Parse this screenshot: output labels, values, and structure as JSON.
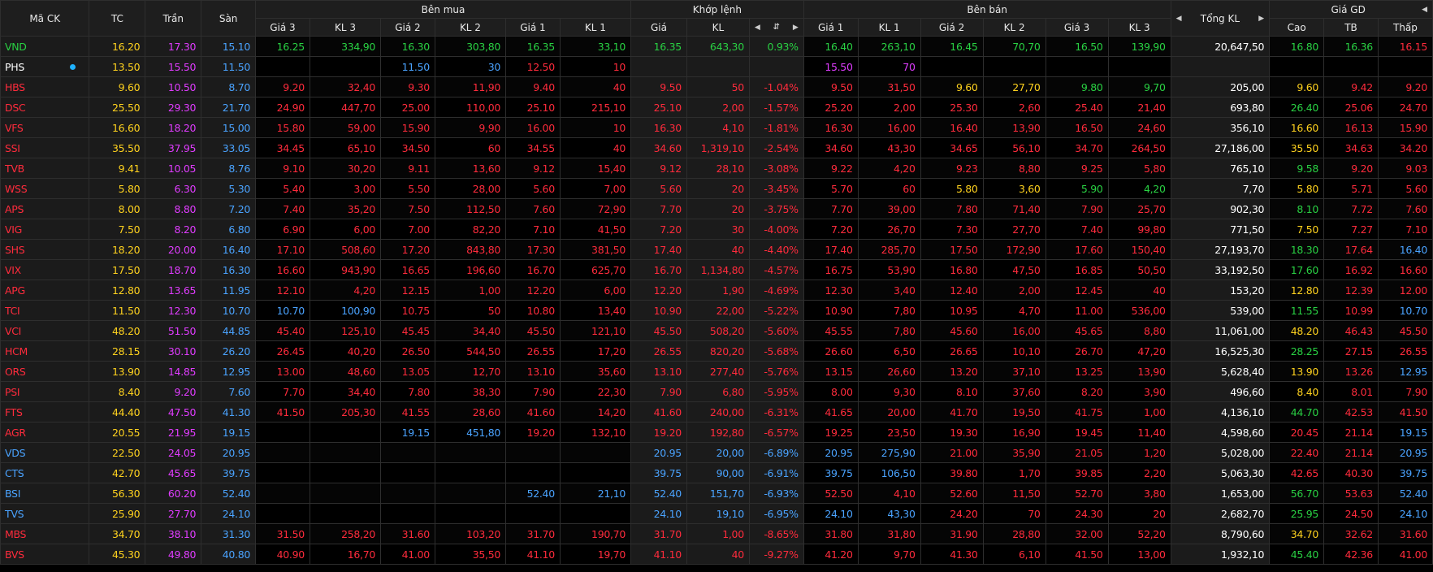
{
  "header": {
    "symbol": "Mã CK",
    "tc": "TC",
    "ceil": "Trần",
    "floor": "Sàn",
    "buy_group": "Bên mua",
    "match_group": "Khớp lệnh",
    "sell_group": "Bên bán",
    "total": "Tổng KL",
    "price_group": "Giá GD",
    "buy_cols": [
      "Giá 3",
      "KL 3",
      "Giá 2",
      "KL 2",
      "Giá 1",
      "KL 1"
    ],
    "match_cols": [
      "Giá",
      "KL",
      "%"
    ],
    "sell_cols": [
      "Giá 1",
      "KL 1",
      "Giá 2",
      "KL 2",
      "Giá 3",
      "KL 3"
    ],
    "price_cols": [
      "Cao",
      "TB",
      "Thấp"
    ],
    "pct_icon": "sort-icon",
    "left_arrow_icon": "caret-left-icon",
    "right_arrow_icon": "caret-right-icon"
  },
  "colors": {
    "up": "#29d143",
    "down": "#ff2b3c",
    "reference": "#ffd21e",
    "ceiling": "#e03cff",
    "floor": "#4aa3ff",
    "neutral": "#ffffff"
  },
  "rows": [
    {
      "s": "VND",
      "tc": "16.20",
      "tr": "17.30",
      "sa": "15.10",
      "b3": "16.25",
      "k3": "334,90",
      "b2": "16.30",
      "k2": "303,80",
      "b1": "16.35",
      "k1": "33,10",
      "mp": "16.35",
      "mk": "643,30",
      "pc": "0.93%",
      "s1": "16.40",
      "q1": "263,10",
      "s2": "16.45",
      "q2": "70,70",
      "s3": "16.50",
      "q3": "139,90",
      "tot": "20,647,50",
      "hi": "16.80",
      "av": "16.36",
      "lo": "16.15",
      "cs": "u",
      "cb3": "u",
      "cb2": "u",
      "cb1": "u",
      "cm": "u",
      "cs1": "u",
      "cs2": "u",
      "cs3": "u",
      "chi": "u",
      "cav": "u",
      "clo": "d"
    },
    {
      "s": "PHS",
      "tc": "13.50",
      "tr": "15.50",
      "sa": "11.50",
      "b3": "",
      "k3": "",
      "b2": "11.50",
      "k2": "30",
      "b1": "12.50",
      "k1": "10",
      "mp": "",
      "mk": "",
      "pc": "",
      "s1": "15.50",
      "q1": "70",
      "s2": "",
      "q2": "",
      "s3": "",
      "q3": "",
      "tot": "",
      "hi": "",
      "av": "",
      "lo": "",
      "cs": "w",
      "cb3": "d",
      "cb2": "f",
      "cb1": "d",
      "cm": "w",
      "cs1": "c",
      "cs2": "w",
      "cs3": "w",
      "chi": "w",
      "cav": "w",
      "clo": "w",
      "dot": true
    },
    {
      "s": "HBS",
      "tc": "9.60",
      "tr": "10.50",
      "sa": "8.70",
      "b3": "9.20",
      "k3": "32,40",
      "b2": "9.30",
      "k2": "11,90",
      "b1": "9.40",
      "k1": "40",
      "mp": "9.50",
      "mk": "50",
      "pc": "-1.04%",
      "s1": "9.50",
      "q1": "31,50",
      "s2": "9.60",
      "q2": "27,70",
      "s3": "9.80",
      "q3": "9,70",
      "tot": "205,00",
      "hi": "9.60",
      "av": "9.42",
      "lo": "9.20",
      "cs": "d",
      "cb3": "d",
      "cb2": "d",
      "cb1": "d",
      "cm": "d",
      "cs1": "d",
      "cs2": "r",
      "cs3": "u",
      "chi": "r",
      "cav": "d",
      "clo": "d"
    },
    {
      "s": "DSC",
      "tc": "25.50",
      "tr": "29.30",
      "sa": "21.70",
      "b3": "24.90",
      "k3": "447,70",
      "b2": "25.00",
      "k2": "110,00",
      "b1": "25.10",
      "k1": "215,10",
      "mp": "25.10",
      "mk": "2,00",
      "pc": "-1.57%",
      "s1": "25.20",
      "q1": "2,00",
      "s2": "25.30",
      "q2": "2,60",
      "s3": "25.40",
      "q3": "21,40",
      "tot": "693,80",
      "hi": "26.40",
      "av": "25.06",
      "lo": "24.70",
      "cs": "d",
      "cb3": "d",
      "cb2": "d",
      "cb1": "d",
      "cm": "d",
      "cs1": "d",
      "cs2": "d",
      "cs3": "d",
      "chi": "u",
      "cav": "d",
      "clo": "d"
    },
    {
      "s": "VFS",
      "tc": "16.60",
      "tr": "18.20",
      "sa": "15.00",
      "b3": "15.80",
      "k3": "59,00",
      "b2": "15.90",
      "k2": "9,90",
      "b1": "16.00",
      "k1": "10",
      "mp": "16.30",
      "mk": "4,10",
      "pc": "-1.81%",
      "s1": "16.30",
      "q1": "16,00",
      "s2": "16.40",
      "q2": "13,90",
      "s3": "16.50",
      "q3": "24,60",
      "tot": "356,10",
      "hi": "16.60",
      "av": "16.13",
      "lo": "15.90",
      "cs": "d",
      "cb3": "d",
      "cb2": "d",
      "cb1": "d",
      "cm": "d",
      "cs1": "d",
      "cs2": "d",
      "cs3": "d",
      "chi": "r",
      "cav": "d",
      "clo": "d"
    },
    {
      "s": "SSI",
      "tc": "35.50",
      "tr": "37.95",
      "sa": "33.05",
      "b3": "34.45",
      "k3": "65,10",
      "b2": "34.50",
      "k2": "60",
      "b1": "34.55",
      "k1": "40",
      "mp": "34.60",
      "mk": "1,319,10",
      "pc": "-2.54%",
      "s1": "34.60",
      "q1": "43,30",
      "s2": "34.65",
      "q2": "56,10",
      "s3": "34.70",
      "q3": "264,50",
      "tot": "27,186,00",
      "hi": "35.50",
      "av": "34.63",
      "lo": "34.20",
      "cs": "d",
      "cb3": "d",
      "cb2": "d",
      "cb1": "d",
      "cm": "d",
      "cs1": "d",
      "cs2": "d",
      "cs3": "d",
      "chi": "r",
      "cav": "d",
      "clo": "d"
    },
    {
      "s": "TVB",
      "tc": "9.41",
      "tr": "10.05",
      "sa": "8.76",
      "b3": "9.10",
      "k3": "30,20",
      "b2": "9.11",
      "k2": "13,60",
      "b1": "9.12",
      "k1": "15,40",
      "mp": "9.12",
      "mk": "28,10",
      "pc": "-3.08%",
      "s1": "9.22",
      "q1": "4,20",
      "s2": "9.23",
      "q2": "8,80",
      "s3": "9.25",
      "q3": "5,80",
      "tot": "765,10",
      "hi": "9.58",
      "av": "9.20",
      "lo": "9.03",
      "cs": "d",
      "cb3": "d",
      "cb2": "d",
      "cb1": "d",
      "cm": "d",
      "cs1": "d",
      "cs2": "d",
      "cs3": "d",
      "chi": "u",
      "cav": "d",
      "clo": "d"
    },
    {
      "s": "WSS",
      "tc": "5.80",
      "tr": "6.30",
      "sa": "5.30",
      "b3": "5.40",
      "k3": "3,00",
      "b2": "5.50",
      "k2": "28,00",
      "b1": "5.60",
      "k1": "7,00",
      "mp": "5.60",
      "mk": "20",
      "pc": "-3.45%",
      "s1": "5.70",
      "q1": "60",
      "s2": "5.80",
      "q2": "3,60",
      "s3": "5.90",
      "q3": "4,20",
      "tot": "7,70",
      "hi": "5.80",
      "av": "5.71",
      "lo": "5.60",
      "cs": "d",
      "cb3": "d",
      "cb2": "d",
      "cb1": "d",
      "cm": "d",
      "cs1": "d",
      "cs2": "r",
      "cs3": "u",
      "chi": "r",
      "cav": "d",
      "clo": "d"
    },
    {
      "s": "APS",
      "tc": "8.00",
      "tr": "8.80",
      "sa": "7.20",
      "b3": "7.40",
      "k3": "35,20",
      "b2": "7.50",
      "k2": "112,50",
      "b1": "7.60",
      "k1": "72,90",
      "mp": "7.70",
      "mk": "20",
      "pc": "-3.75%",
      "s1": "7.70",
      "q1": "39,00",
      "s2": "7.80",
      "q2": "71,40",
      "s3": "7.90",
      "q3": "25,70",
      "tot": "902,30",
      "hi": "8.10",
      "av": "7.72",
      "lo": "7.60",
      "cs": "d",
      "cb3": "d",
      "cb2": "d",
      "cb1": "d",
      "cm": "d",
      "cs1": "d",
      "cs2": "d",
      "cs3": "d",
      "chi": "u",
      "cav": "d",
      "clo": "d"
    },
    {
      "s": "VIG",
      "tc": "7.50",
      "tr": "8.20",
      "sa": "6.80",
      "b3": "6.90",
      "k3": "6,00",
      "b2": "7.00",
      "k2": "82,20",
      "b1": "7.10",
      "k1": "41,50",
      "mp": "7.20",
      "mk": "30",
      "pc": "-4.00%",
      "s1": "7.20",
      "q1": "26,70",
      "s2": "7.30",
      "q2": "27,70",
      "s3": "7.40",
      "q3": "99,80",
      "tot": "771,50",
      "hi": "7.50",
      "av": "7.27",
      "lo": "7.10",
      "cs": "d",
      "cb3": "d",
      "cb2": "d",
      "cb1": "d",
      "cm": "d",
      "cs1": "d",
      "cs2": "d",
      "cs3": "d",
      "chi": "r",
      "cav": "d",
      "clo": "d"
    },
    {
      "s": "SHS",
      "tc": "18.20",
      "tr": "20.00",
      "sa": "16.40",
      "b3": "17.10",
      "k3": "508,60",
      "b2": "17.20",
      "k2": "843,80",
      "b1": "17.30",
      "k1": "381,50",
      "mp": "17.40",
      "mk": "40",
      "pc": "-4.40%",
      "s1": "17.40",
      "q1": "285,70",
      "s2": "17.50",
      "q2": "172,90",
      "s3": "17.60",
      "q3": "150,40",
      "tot": "27,193,70",
      "hi": "18.30",
      "av": "17.64",
      "lo": "16.40",
      "cs": "d",
      "cb3": "d",
      "cb2": "d",
      "cb1": "d",
      "cm": "d",
      "cs1": "d",
      "cs2": "d",
      "cs3": "d",
      "chi": "u",
      "cav": "d",
      "clo": "f"
    },
    {
      "s": "VIX",
      "tc": "17.50",
      "tr": "18.70",
      "sa": "16.30",
      "b3": "16.60",
      "k3": "943,90",
      "b2": "16.65",
      "k2": "196,60",
      "b1": "16.70",
      "k1": "625,70",
      "mp": "16.70",
      "mk": "1,134,80",
      "pc": "-4.57%",
      "s1": "16.75",
      "q1": "53,90",
      "s2": "16.80",
      "q2": "47,50",
      "s3": "16.85",
      "q3": "50,50",
      "tot": "33,192,50",
      "hi": "17.60",
      "av": "16.92",
      "lo": "16.60",
      "cs": "d",
      "cb3": "d",
      "cb2": "d",
      "cb1": "d",
      "cm": "d",
      "cs1": "d",
      "cs2": "d",
      "cs3": "d",
      "chi": "u",
      "cav": "d",
      "clo": "d"
    },
    {
      "s": "APG",
      "tc": "12.80",
      "tr": "13.65",
      "sa": "11.95",
      "b3": "12.10",
      "k3": "4,20",
      "b2": "12.15",
      "k2": "1,00",
      "b1": "12.20",
      "k1": "6,00",
      "mp": "12.20",
      "mk": "1,90",
      "pc": "-4.69%",
      "s1": "12.30",
      "q1": "3,40",
      "s2": "12.40",
      "q2": "2,00",
      "s3": "12.45",
      "q3": "40",
      "tot": "153,20",
      "hi": "12.80",
      "av": "12.39",
      "lo": "12.00",
      "cs": "d",
      "cb3": "d",
      "cb2": "d",
      "cb1": "d",
      "cm": "d",
      "cs1": "d",
      "cs2": "d",
      "cs3": "d",
      "chi": "r",
      "cav": "d",
      "clo": "d"
    },
    {
      "s": "TCI",
      "tc": "11.50",
      "tr": "12.30",
      "sa": "10.70",
      "b3": "10.70",
      "k3": "100,90",
      "b2": "10.75",
      "k2": "50",
      "b1": "10.80",
      "k1": "13,40",
      "mp": "10.90",
      "mk": "22,00",
      "pc": "-5.22%",
      "s1": "10.90",
      "q1": "7,80",
      "s2": "10.95",
      "q2": "4,70",
      "s3": "11.00",
      "q3": "536,00",
      "tot": "539,00",
      "hi": "11.55",
      "av": "10.99",
      "lo": "10.70",
      "cs": "d",
      "cb3": "f",
      "cb2": "d",
      "cb1": "d",
      "cm": "d",
      "cs1": "d",
      "cs2": "d",
      "cs3": "d",
      "chi": "u",
      "cav": "d",
      "clo": "f"
    },
    {
      "s": "VCI",
      "tc": "48.20",
      "tr": "51.50",
      "sa": "44.85",
      "b3": "45.40",
      "k3": "125,10",
      "b2": "45.45",
      "k2": "34,40",
      "b1": "45.50",
      "k1": "121,10",
      "mp": "45.50",
      "mk": "508,20",
      "pc": "-5.60%",
      "s1": "45.55",
      "q1": "7,80",
      "s2": "45.60",
      "q2": "16,00",
      "s3": "45.65",
      "q3": "8,80",
      "tot": "11,061,00",
      "hi": "48.20",
      "av": "46.43",
      "lo": "45.50",
      "cs": "d",
      "cb3": "d",
      "cb2": "d",
      "cb1": "d",
      "cm": "d",
      "cs1": "d",
      "cs2": "d",
      "cs3": "d",
      "chi": "r",
      "cav": "d",
      "clo": "d"
    },
    {
      "s": "HCM",
      "tc": "28.15",
      "tr": "30.10",
      "sa": "26.20",
      "b3": "26.45",
      "k3": "40,20",
      "b2": "26.50",
      "k2": "544,50",
      "b1": "26.55",
      "k1": "17,20",
      "mp": "26.55",
      "mk": "820,20",
      "pc": "-5.68%",
      "s1": "26.60",
      "q1": "6,50",
      "s2": "26.65",
      "q2": "10,10",
      "s3": "26.70",
      "q3": "47,20",
      "tot": "16,525,30",
      "hi": "28.25",
      "av": "27.15",
      "lo": "26.55",
      "cs": "d",
      "cb3": "d",
      "cb2": "d",
      "cb1": "d",
      "cm": "d",
      "cs1": "d",
      "cs2": "d",
      "cs3": "d",
      "chi": "u",
      "cav": "d",
      "clo": "d"
    },
    {
      "s": "ORS",
      "tc": "13.90",
      "tr": "14.85",
      "sa": "12.95",
      "b3": "13.00",
      "k3": "48,60",
      "b2": "13.05",
      "k2": "12,70",
      "b1": "13.10",
      "k1": "35,60",
      "mp": "13.10",
      "mk": "277,40",
      "pc": "-5.76%",
      "s1": "13.15",
      "q1": "26,60",
      "s2": "13.20",
      "q2": "37,10",
      "s3": "13.25",
      "q3": "13,90",
      "tot": "5,628,40",
      "hi": "13.90",
      "av": "13.26",
      "lo": "12.95",
      "cs": "d",
      "cb3": "d",
      "cb2": "d",
      "cb1": "d",
      "cm": "d",
      "cs1": "d",
      "cs2": "d",
      "cs3": "d",
      "chi": "r",
      "cav": "d",
      "clo": "f"
    },
    {
      "s": "PSI",
      "tc": "8.40",
      "tr": "9.20",
      "sa": "7.60",
      "b3": "7.70",
      "k3": "34,40",
      "b2": "7.80",
      "k2": "38,30",
      "b1": "7.90",
      "k1": "22,30",
      "mp": "7.90",
      "mk": "6,80",
      "pc": "-5.95%",
      "s1": "8.00",
      "q1": "9,30",
      "s2": "8.10",
      "q2": "37,60",
      "s3": "8.20",
      "q3": "3,90",
      "tot": "496,60",
      "hi": "8.40",
      "av": "8.01",
      "lo": "7.90",
      "cs": "d",
      "cb3": "d",
      "cb2": "d",
      "cb1": "d",
      "cm": "d",
      "cs1": "d",
      "cs2": "d",
      "cs3": "d",
      "chi": "r",
      "cav": "d",
      "clo": "d"
    },
    {
      "s": "FTS",
      "tc": "44.40",
      "tr": "47.50",
      "sa": "41.30",
      "b3": "41.50",
      "k3": "205,30",
      "b2": "41.55",
      "k2": "28,60",
      "b1": "41.60",
      "k1": "14,20",
      "mp": "41.60",
      "mk": "240,00",
      "pc": "-6.31%",
      "s1": "41.65",
      "q1": "20,00",
      "s2": "41.70",
      "q2": "19,50",
      "s3": "41.75",
      "q3": "1,00",
      "tot": "4,136,10",
      "hi": "44.70",
      "av": "42.53",
      "lo": "41.50",
      "cs": "d",
      "cb3": "d",
      "cb2": "d",
      "cb1": "d",
      "cm": "d",
      "cs1": "d",
      "cs2": "d",
      "cs3": "d",
      "chi": "u",
      "cav": "d",
      "clo": "d"
    },
    {
      "s": "AGR",
      "tc": "20.55",
      "tr": "21.95",
      "sa": "19.15",
      "b3": "",
      "k3": "",
      "b2": "19.15",
      "k2": "451,80",
      "b1": "19.20",
      "k1": "132,10",
      "mp": "19.20",
      "mk": "192,80",
      "pc": "-6.57%",
      "s1": "19.25",
      "q1": "23,50",
      "s2": "19.30",
      "q2": "16,90",
      "s3": "19.45",
      "q3": "11,40",
      "tot": "4,598,60",
      "hi": "20.45",
      "av": "21.14",
      "lo": "19.15",
      "cs": "d",
      "cb3": "d",
      "cb2": "f",
      "cb1": "d",
      "cm": "d",
      "cs1": "d",
      "cs2": "d",
      "cs3": "d",
      "chi": "d",
      "cav": "d",
      "clo": "f"
    },
    {
      "s": "VDS",
      "tc": "22.50",
      "tr": "24.05",
      "sa": "20.95",
      "b3": "",
      "k3": "",
      "b2": "",
      "k2": "",
      "b1": "",
      "k1": "",
      "mp": "20.95",
      "mk": "20,00",
      "pc": "-6.89%",
      "s1": "20.95",
      "q1": "275,90",
      "s2": "21.00",
      "q2": "35,90",
      "s3": "21.05",
      "q3": "1,20",
      "tot": "5,028,00",
      "hi": "22.40",
      "av": "21.14",
      "lo": "20.95",
      "cs": "f",
      "cb3": "d",
      "cb2": "d",
      "cb1": "d",
      "cm": "f",
      "cs1": "f",
      "cs2": "d",
      "cs3": "d",
      "chi": "d",
      "cav": "d",
      "clo": "f"
    },
    {
      "s": "CTS",
      "tc": "42.70",
      "tr": "45.65",
      "sa": "39.75",
      "b3": "",
      "k3": "",
      "b2": "",
      "k2": "",
      "b1": "",
      "k1": "",
      "mp": "39.75",
      "mk": "90,00",
      "pc": "-6.91%",
      "s1": "39.75",
      "q1": "106,50",
      "s2": "39.80",
      "q2": "1,70",
      "s3": "39.85",
      "q3": "2,20",
      "tot": "5,063,30",
      "hi": "42.65",
      "av": "40.30",
      "lo": "39.75",
      "cs": "f",
      "cb3": "d",
      "cb2": "d",
      "cb1": "d",
      "cm": "f",
      "cs1": "f",
      "cs2": "d",
      "cs3": "d",
      "chi": "d",
      "cav": "d",
      "clo": "f"
    },
    {
      "s": "BSI",
      "tc": "56.30",
      "tr": "60.20",
      "sa": "52.40",
      "b3": "",
      "k3": "",
      "b2": "",
      "k2": "",
      "b1": "52.40",
      "k1": "21,10",
      "mp": "52.40",
      "mk": "151,70",
      "pc": "-6.93%",
      "s1": "52.50",
      "q1": "4,10",
      "s2": "52.60",
      "q2": "11,50",
      "s3": "52.70",
      "q3": "3,80",
      "tot": "1,653,00",
      "hi": "56.70",
      "av": "53.63",
      "lo": "52.40",
      "cs": "f",
      "cb3": "d",
      "cb2": "d",
      "cb1": "f",
      "cm": "f",
      "cs1": "d",
      "cs2": "d",
      "cs3": "d",
      "chi": "u",
      "cav": "d",
      "clo": "f"
    },
    {
      "s": "TVS",
      "tc": "25.90",
      "tr": "27.70",
      "sa": "24.10",
      "b3": "",
      "k3": "",
      "b2": "",
      "k2": "",
      "b1": "",
      "k1": "",
      "mp": "24.10",
      "mk": "19,10",
      "pc": "-6.95%",
      "s1": "24.10",
      "q1": "43,30",
      "s2": "24.20",
      "q2": "70",
      "s3": "24.30",
      "q3": "20",
      "tot": "2,682,70",
      "hi": "25.95",
      "av": "24.50",
      "lo": "24.10",
      "cs": "f",
      "cb3": "d",
      "cb2": "d",
      "cb1": "d",
      "cm": "f",
      "cs1": "f",
      "cs2": "d",
      "cs3": "d",
      "chi": "u",
      "cav": "d",
      "clo": "f"
    },
    {
      "s": "MBS",
      "tc": "34.70",
      "tr": "38.10",
      "sa": "31.30",
      "b3": "31.50",
      "k3": "258,20",
      "b2": "31.60",
      "k2": "103,20",
      "b1": "31.70",
      "k1": "190,70",
      "mp": "31.70",
      "mk": "1,00",
      "pc": "-8.65%",
      "s1": "31.80",
      "q1": "31,80",
      "s2": "31.90",
      "q2": "28,80",
      "s3": "32.00",
      "q3": "52,20",
      "tot": "8,790,60",
      "hi": "34.70",
      "av": "32.62",
      "lo": "31.60",
      "cs": "d",
      "cb3": "d",
      "cb2": "d",
      "cb1": "d",
      "cm": "d",
      "cs1": "d",
      "cs2": "d",
      "cs3": "d",
      "chi": "r",
      "cav": "d",
      "clo": "d"
    },
    {
      "s": "BVS",
      "tc": "45.30",
      "tr": "49.80",
      "sa": "40.80",
      "b3": "40.90",
      "k3": "16,70",
      "b2": "41.00",
      "k2": "35,50",
      "b1": "41.10",
      "k1": "19,70",
      "mp": "41.10",
      "mk": "40",
      "pc": "-9.27%",
      "s1": "41.20",
      "q1": "9,70",
      "s2": "41.30",
      "q2": "6,10",
      "s3": "41.50",
      "q3": "13,00",
      "tot": "1,932,10",
      "hi": "45.40",
      "av": "42.36",
      "lo": "41.00",
      "cs": "d",
      "cb3": "d",
      "cb2": "d",
      "cb1": "d",
      "cm": "d",
      "cs1": "d",
      "cs2": "d",
      "cs3": "d",
      "chi": "u",
      "cav": "d",
      "clo": "d"
    }
  ]
}
